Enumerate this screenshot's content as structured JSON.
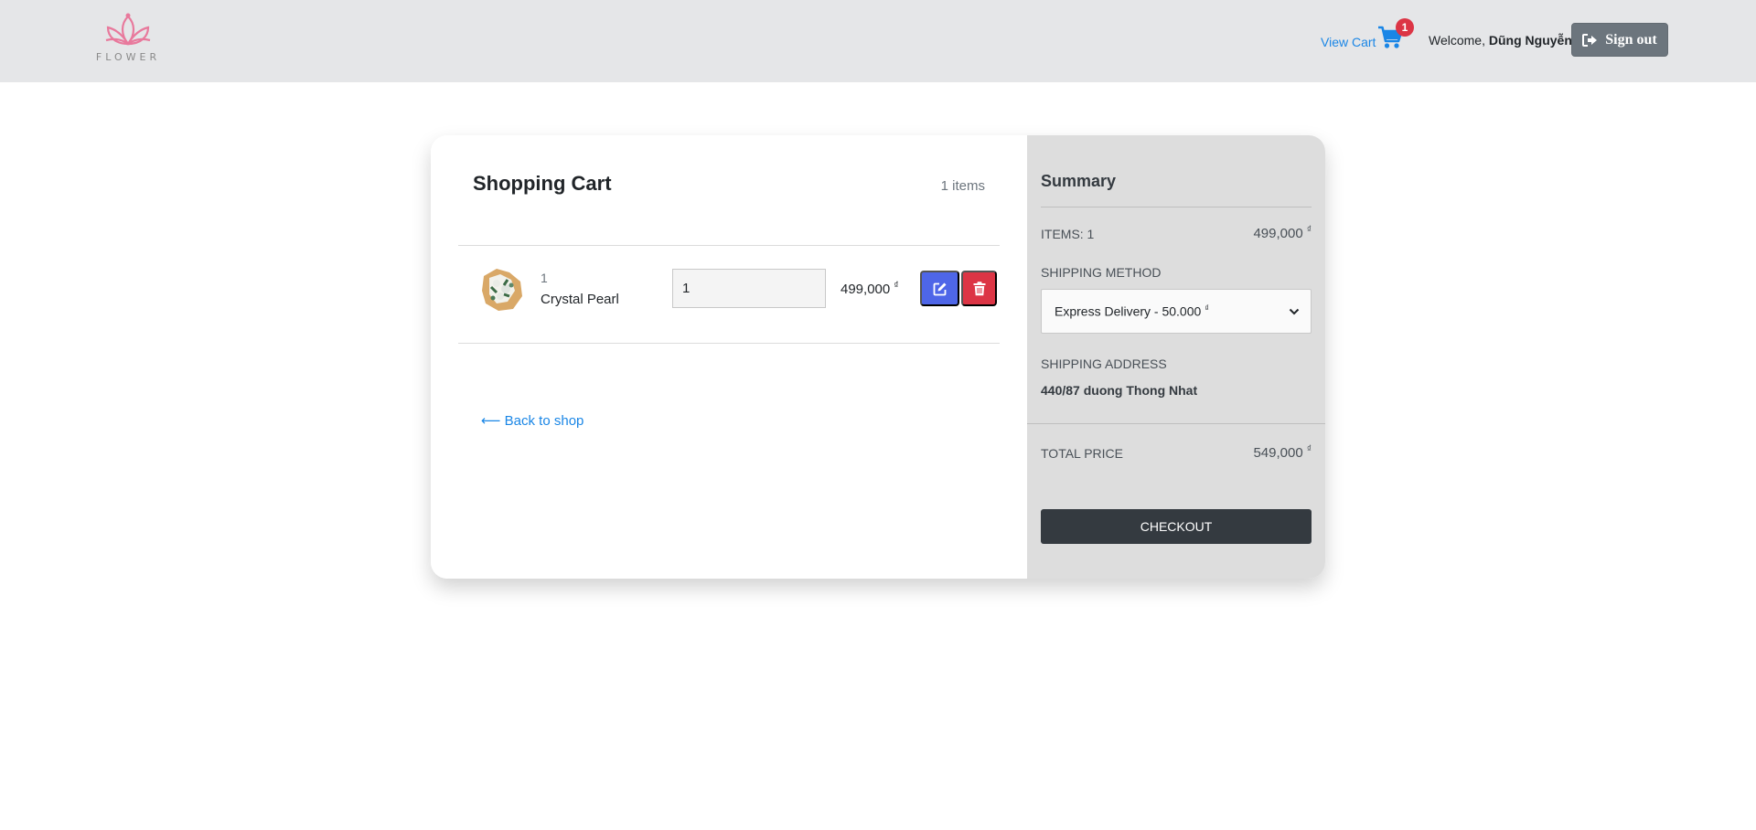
{
  "header": {
    "logo_text": "FLOWER",
    "view_cart_label": "View Cart",
    "cart_badge": "1",
    "welcome_prefix": "Welcome,",
    "user_name": "Dũng Nguyễn",
    "signout_label": "Sign out"
  },
  "cart": {
    "title": "Shopping Cart",
    "count_label": "1 items",
    "items": [
      {
        "quantity_label": "1",
        "name": "Crystal Pearl",
        "quantity_value": "1",
        "price": "499,000",
        "currency": "₫"
      }
    ],
    "back_link": "⟵ Back to shop"
  },
  "summary": {
    "title": "Summary",
    "items_label": "ITEMS: 1",
    "items_price": "499,000",
    "currency": "₫",
    "shipping_method_label": "SHIPPING METHOD",
    "shipping_option": "Express Delivery - 50.000",
    "shipping_address_label": "SHIPPING ADDRESS",
    "shipping_address": "440/87 duong Thong Nhat",
    "total_label": "TOTAL PRICE",
    "total_price": "549,000",
    "checkout_label": "CHECKOUT"
  },
  "colors": {
    "header_bg": "#e5e6e8",
    "link": "#1a86e6",
    "badge": "#dc3545",
    "edit_button": "#4e66e8",
    "delete_button": "#dc3545",
    "summary_bg": "#dddddd",
    "checkout_bg": "#343a40",
    "signout_bg": "#6c757d",
    "logo_pink": "#e8799c"
  },
  "icons": [
    "lotus-logo-icon",
    "cart-icon",
    "sign-out-icon",
    "edit-icon",
    "trash-icon",
    "chevron-down-icon"
  ]
}
